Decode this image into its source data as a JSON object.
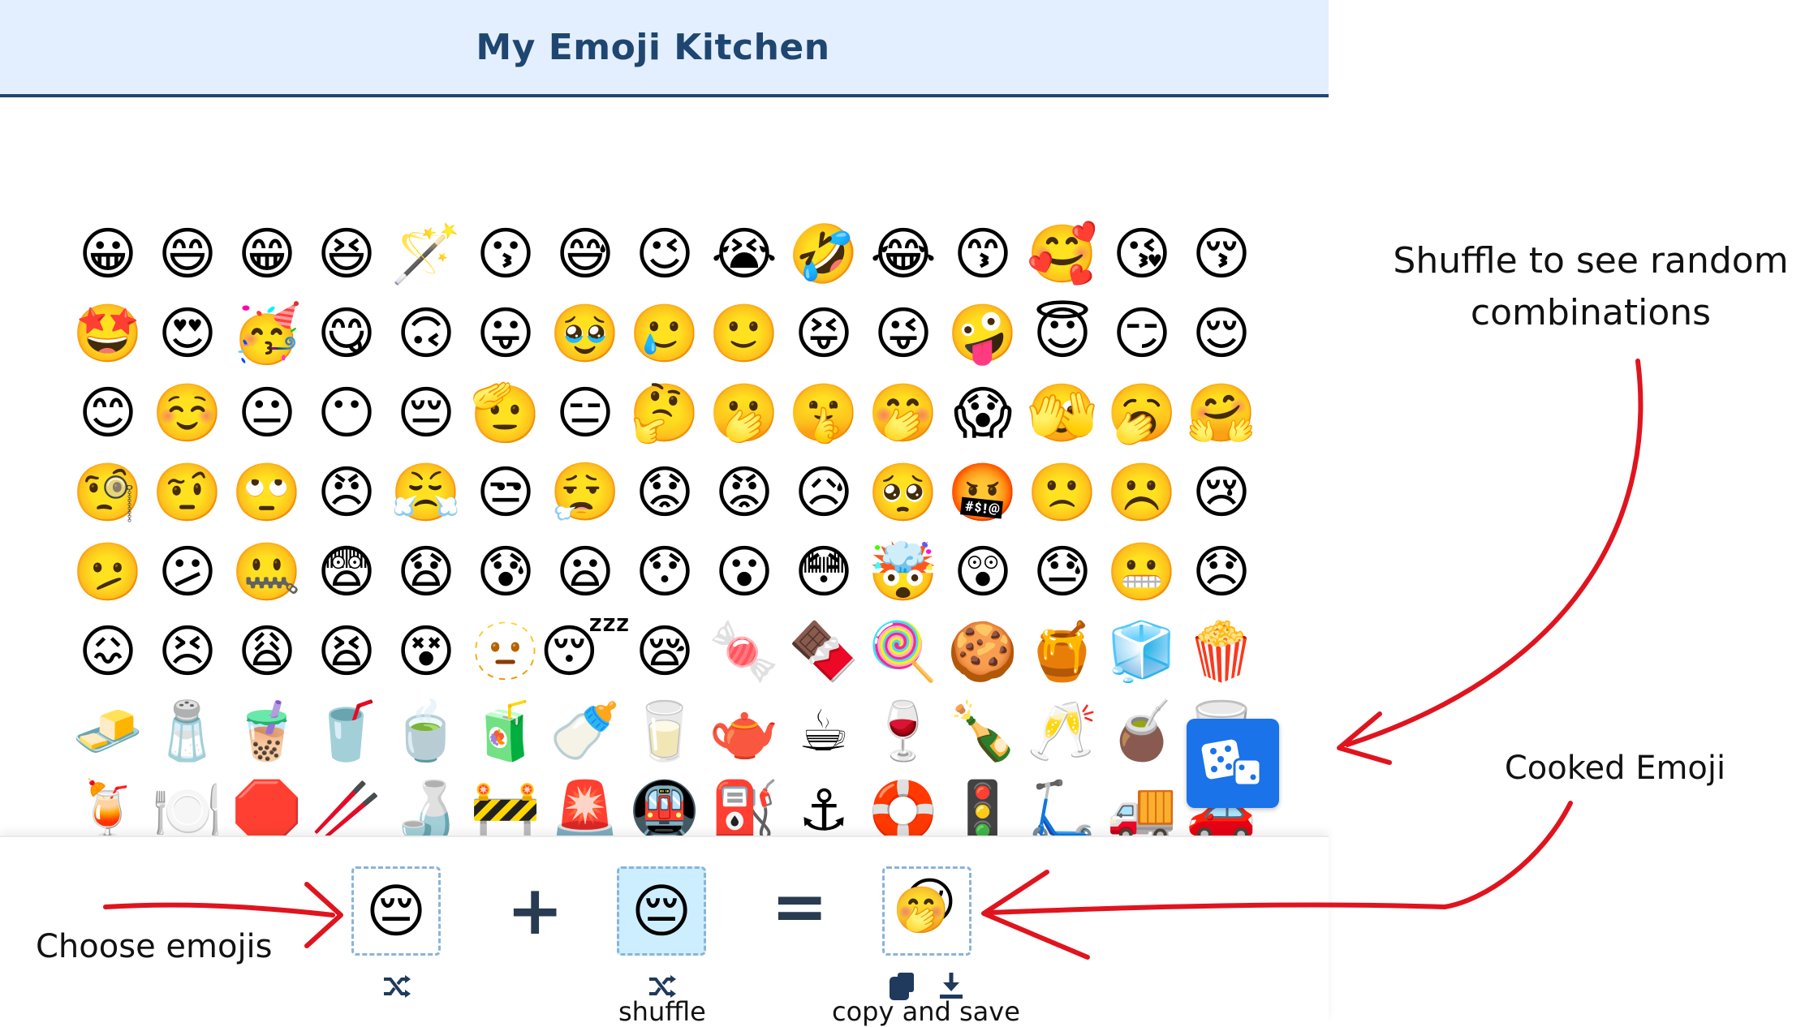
{
  "header": {
    "title": "My Emoji Kitchen"
  },
  "emoji_grid": [
    "😀",
    "😄",
    "😁",
    "😆",
    "🪄",
    "😗",
    "😅",
    "😉",
    "😭",
    "🤣",
    "😂",
    "😙",
    "🥰",
    "😘",
    "😚",
    "🤩",
    "😍",
    "🥳",
    "😋",
    "🙃",
    "😛",
    "🥹",
    "🥲",
    "🙂",
    "😝",
    "😜",
    "🤪",
    "😇",
    "😏",
    "😌",
    "😊",
    "☺️",
    "😐",
    "😶",
    "😔",
    "🫡",
    "😑",
    "🤔",
    "🫢",
    "🤫",
    "🤭",
    "😱",
    "🫣",
    "🥱",
    "🤗",
    "🧐",
    "🤨",
    "🙄",
    "😠",
    "😤",
    "😒",
    "😮‍💨",
    "😟",
    "😡",
    "😥",
    "🥺",
    "🤬",
    "🙁",
    "☹️",
    "😢",
    "🫤",
    "😕",
    "🤐",
    "😨",
    "😧",
    "😰",
    "😦",
    "😯",
    "😮",
    "😳",
    "🤯",
    "😲",
    "😓",
    "😬",
    "😞",
    "😖",
    "😣",
    "😩",
    "😫",
    "😵",
    "🫥",
    "😴",
    "😪",
    "🍬",
    "🍫",
    "🍭",
    "🍪",
    "🍯",
    "🧊",
    "🍿",
    "🧈",
    "🧂",
    "🧋",
    "🥤",
    "🍵",
    "🧃",
    "🍼",
    "🥛",
    "🫖",
    "☕",
    "🍷",
    "🍾",
    "🥂",
    "🧉",
    "🥃",
    "🍹",
    "🍽️",
    "🛑",
    "🥢",
    "🍶",
    "🚧",
    "🚨",
    "🚇",
    "⛽",
    "⚓",
    "🛟",
    "🚦",
    "🛴",
    "🚚",
    "🚗"
  ],
  "kitchen": {
    "left_emoji": "😔",
    "plus": "+",
    "right_emoji": "😔",
    "equals": "=",
    "result_emoji": "🤭",
    "result_overlay_emoji": "😔",
    "shuffle_label": "shuffle",
    "copy_save_label": "copy and save"
  },
  "annotations": {
    "shuffle_note": "Shuffle to see random combinations",
    "cooked_note": "Cooked Emoji",
    "choose_note": "Choose emojis"
  },
  "colors": {
    "header_bg": "#e3efff",
    "title": "#1f4670",
    "dice_button": "#1a73e8",
    "slot_active": "#cdeeff",
    "arrows": "#e0141e"
  },
  "icons": {
    "dice": "dice-icon",
    "shuffle": "shuffle-icon",
    "copy": "copy-icon",
    "download": "download-icon"
  }
}
